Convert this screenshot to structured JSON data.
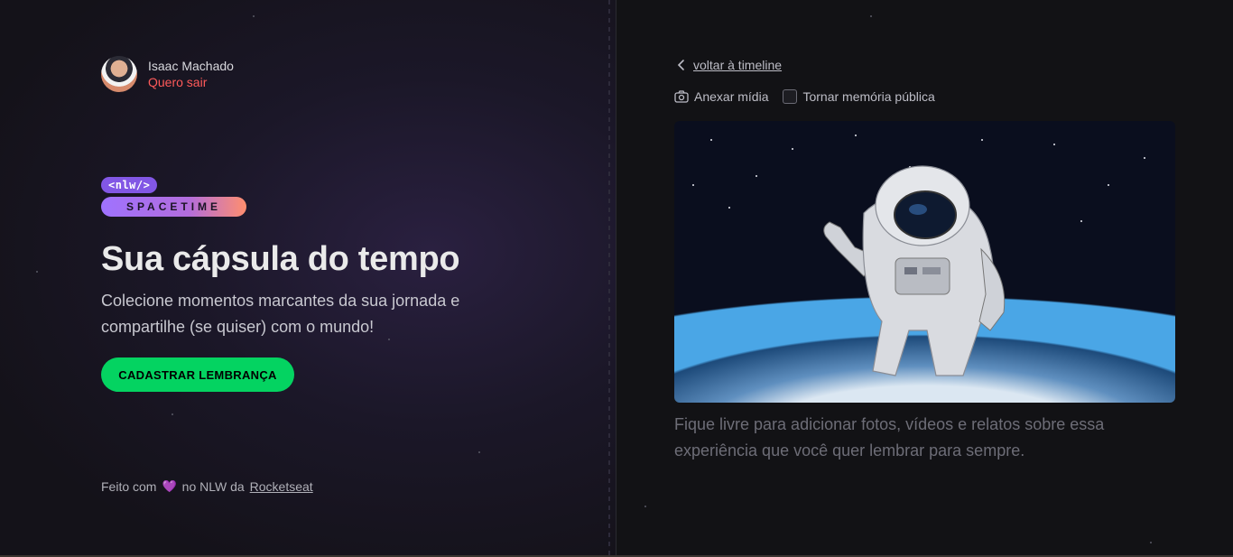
{
  "user": {
    "name": "Isaac Machado",
    "logout_label": "Quero sair"
  },
  "brand": {
    "tag": "<nlw/>",
    "name": "SPACETIME"
  },
  "hero": {
    "title": "Sua cápsula do tempo",
    "description": "Colecione momentos marcantes da sua jornada e compartilhe (se quiser) com o mundo!",
    "cta_label": "CADASTRAR LEMBRANÇA"
  },
  "footer": {
    "prefix": "Feito com",
    "heart_icon": "heart-icon",
    "middle": "no NLW da",
    "link_text": "Rocketseat"
  },
  "form": {
    "back_label": "voltar à timeline",
    "attach_label": "Anexar mídia",
    "public_label": "Tornar memória pública",
    "public_checked": false,
    "textarea_placeholder": "Fique livre para adicionar fotos, vídeos e relatos sobre essa experiência que você quer lembrar para sempre.",
    "textarea_value": ""
  },
  "colors": {
    "accent_green": "#04d361",
    "logout_red": "#ff5a5a",
    "brand_purple": "#8257e5"
  }
}
